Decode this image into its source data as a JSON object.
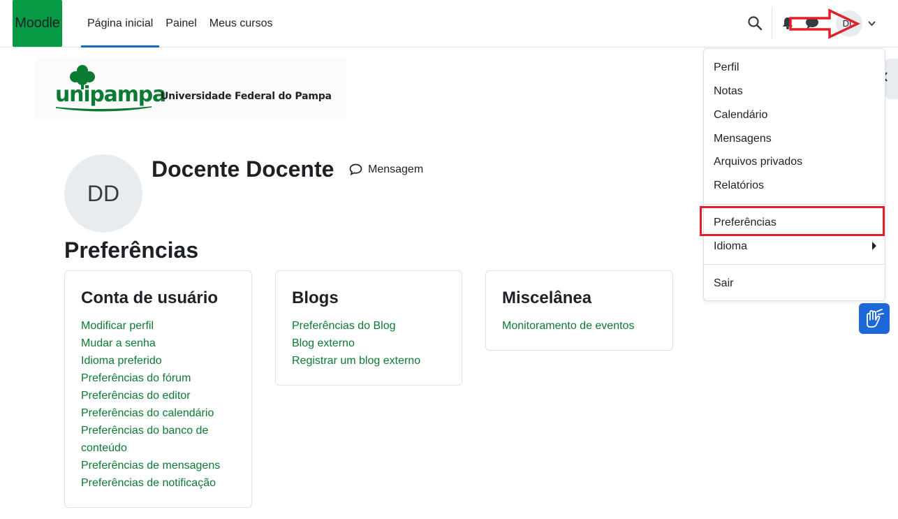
{
  "navbar": {
    "brand": "Moodle",
    "links": [
      {
        "label": "Página inicial",
        "active": true
      },
      {
        "label": "Painel",
        "active": false
      },
      {
        "label": "Meus cursos",
        "active": false
      }
    ],
    "avatar_initials": "DD"
  },
  "logo": {
    "name": "unipampa",
    "subtitle": "Universidade Federal do Pampa"
  },
  "profile": {
    "initials": "DD",
    "name": "Docente Docente",
    "message_label": "Mensagem"
  },
  "page_title": "Preferências",
  "cards": [
    {
      "title": "Conta de usuário",
      "links": [
        "Modificar perfil",
        "Mudar a senha",
        "Idioma preferido",
        "Preferências do fórum",
        "Preferências do editor",
        "Preferências do calendário",
        "Preferências do banco de",
        "conteúdo",
        "Preferências de mensagens",
        "Preferências de notificação"
      ]
    },
    {
      "title": "Blogs",
      "links": [
        "Preferências do Blog",
        "Blog externo",
        "Registrar um blog externo"
      ]
    },
    {
      "title": "Miscelânea",
      "links": [
        "Monitoramento de eventos"
      ]
    }
  ],
  "user_menu": {
    "items": [
      "Perfil",
      "Notas",
      "Calendário",
      "Mensagens",
      "Arquivos privados",
      "Relatórios"
    ],
    "preferences": "Preferências",
    "language": "Idioma",
    "logout": "Sair"
  },
  "colors": {
    "brand": "#069a44",
    "link": "#0b7a33",
    "active_tab": "#0f6cbf",
    "annotation": "#e0202a",
    "vlibras": "#1e67d6"
  }
}
